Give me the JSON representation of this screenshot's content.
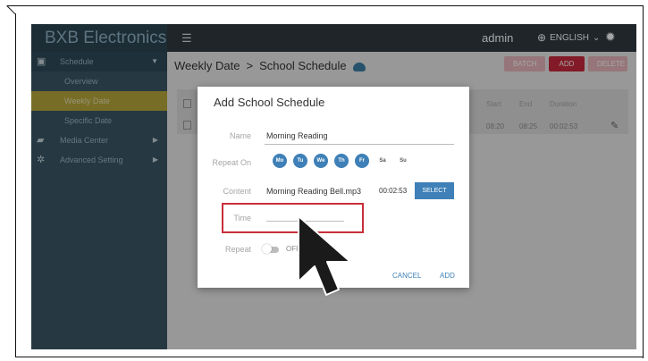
{
  "app": {
    "brand": "BXB Electronics",
    "user": "admin",
    "language": "ENGLISH"
  },
  "sidebar": {
    "items": [
      {
        "label": "Schedule",
        "icon": "calendar-icon"
      },
      {
        "label": "Overview"
      },
      {
        "label": "Weekly Date"
      },
      {
        "label": "Specific Date"
      },
      {
        "label": "Media Center",
        "icon": "folder-icon"
      },
      {
        "label": "Advanced Setting",
        "icon": "gear-icon"
      }
    ]
  },
  "main": {
    "breadcrumb": {
      "first": "Weekly Date",
      "separator": ">",
      "second": "School Schedule"
    },
    "buttons": {
      "batch": "BATCH",
      "add": "ADD",
      "delete": "DELETE"
    },
    "table": {
      "headers": {
        "start": "Start",
        "end": "End",
        "duration": "Duration"
      },
      "row": {
        "start": "08:20",
        "end": "08:25",
        "duration": "00:02:53"
      }
    }
  },
  "modal": {
    "title": "Add School Schedule",
    "name_label": "Name",
    "name_value": "Morning Reading",
    "repeat_on_label": "Repeat On",
    "days": [
      {
        "label": "Mo",
        "selected": true
      },
      {
        "label": "Tu",
        "selected": true
      },
      {
        "label": "We",
        "selected": true
      },
      {
        "label": "Th",
        "selected": true
      },
      {
        "label": "Fr",
        "selected": true
      },
      {
        "label": "Sa",
        "selected": false
      },
      {
        "label": "Su",
        "selected": false
      }
    ],
    "content_label": "Content",
    "content_value": "Morning Reading Bell.mp3",
    "content_duration": "00:02:53",
    "select_button": "SELECT",
    "time_label": "Time",
    "repeat_label": "Repeat",
    "repeat_state": "OFF",
    "cancel": "CANCEL",
    "add": "ADD"
  },
  "colors": {
    "sidebar": "#3b5866",
    "topbar": "#303a40",
    "accent": "#3e80b7",
    "active_item": "#b8a83b",
    "danger": "#c8283c",
    "highlight_box": "#c82f3a"
  }
}
